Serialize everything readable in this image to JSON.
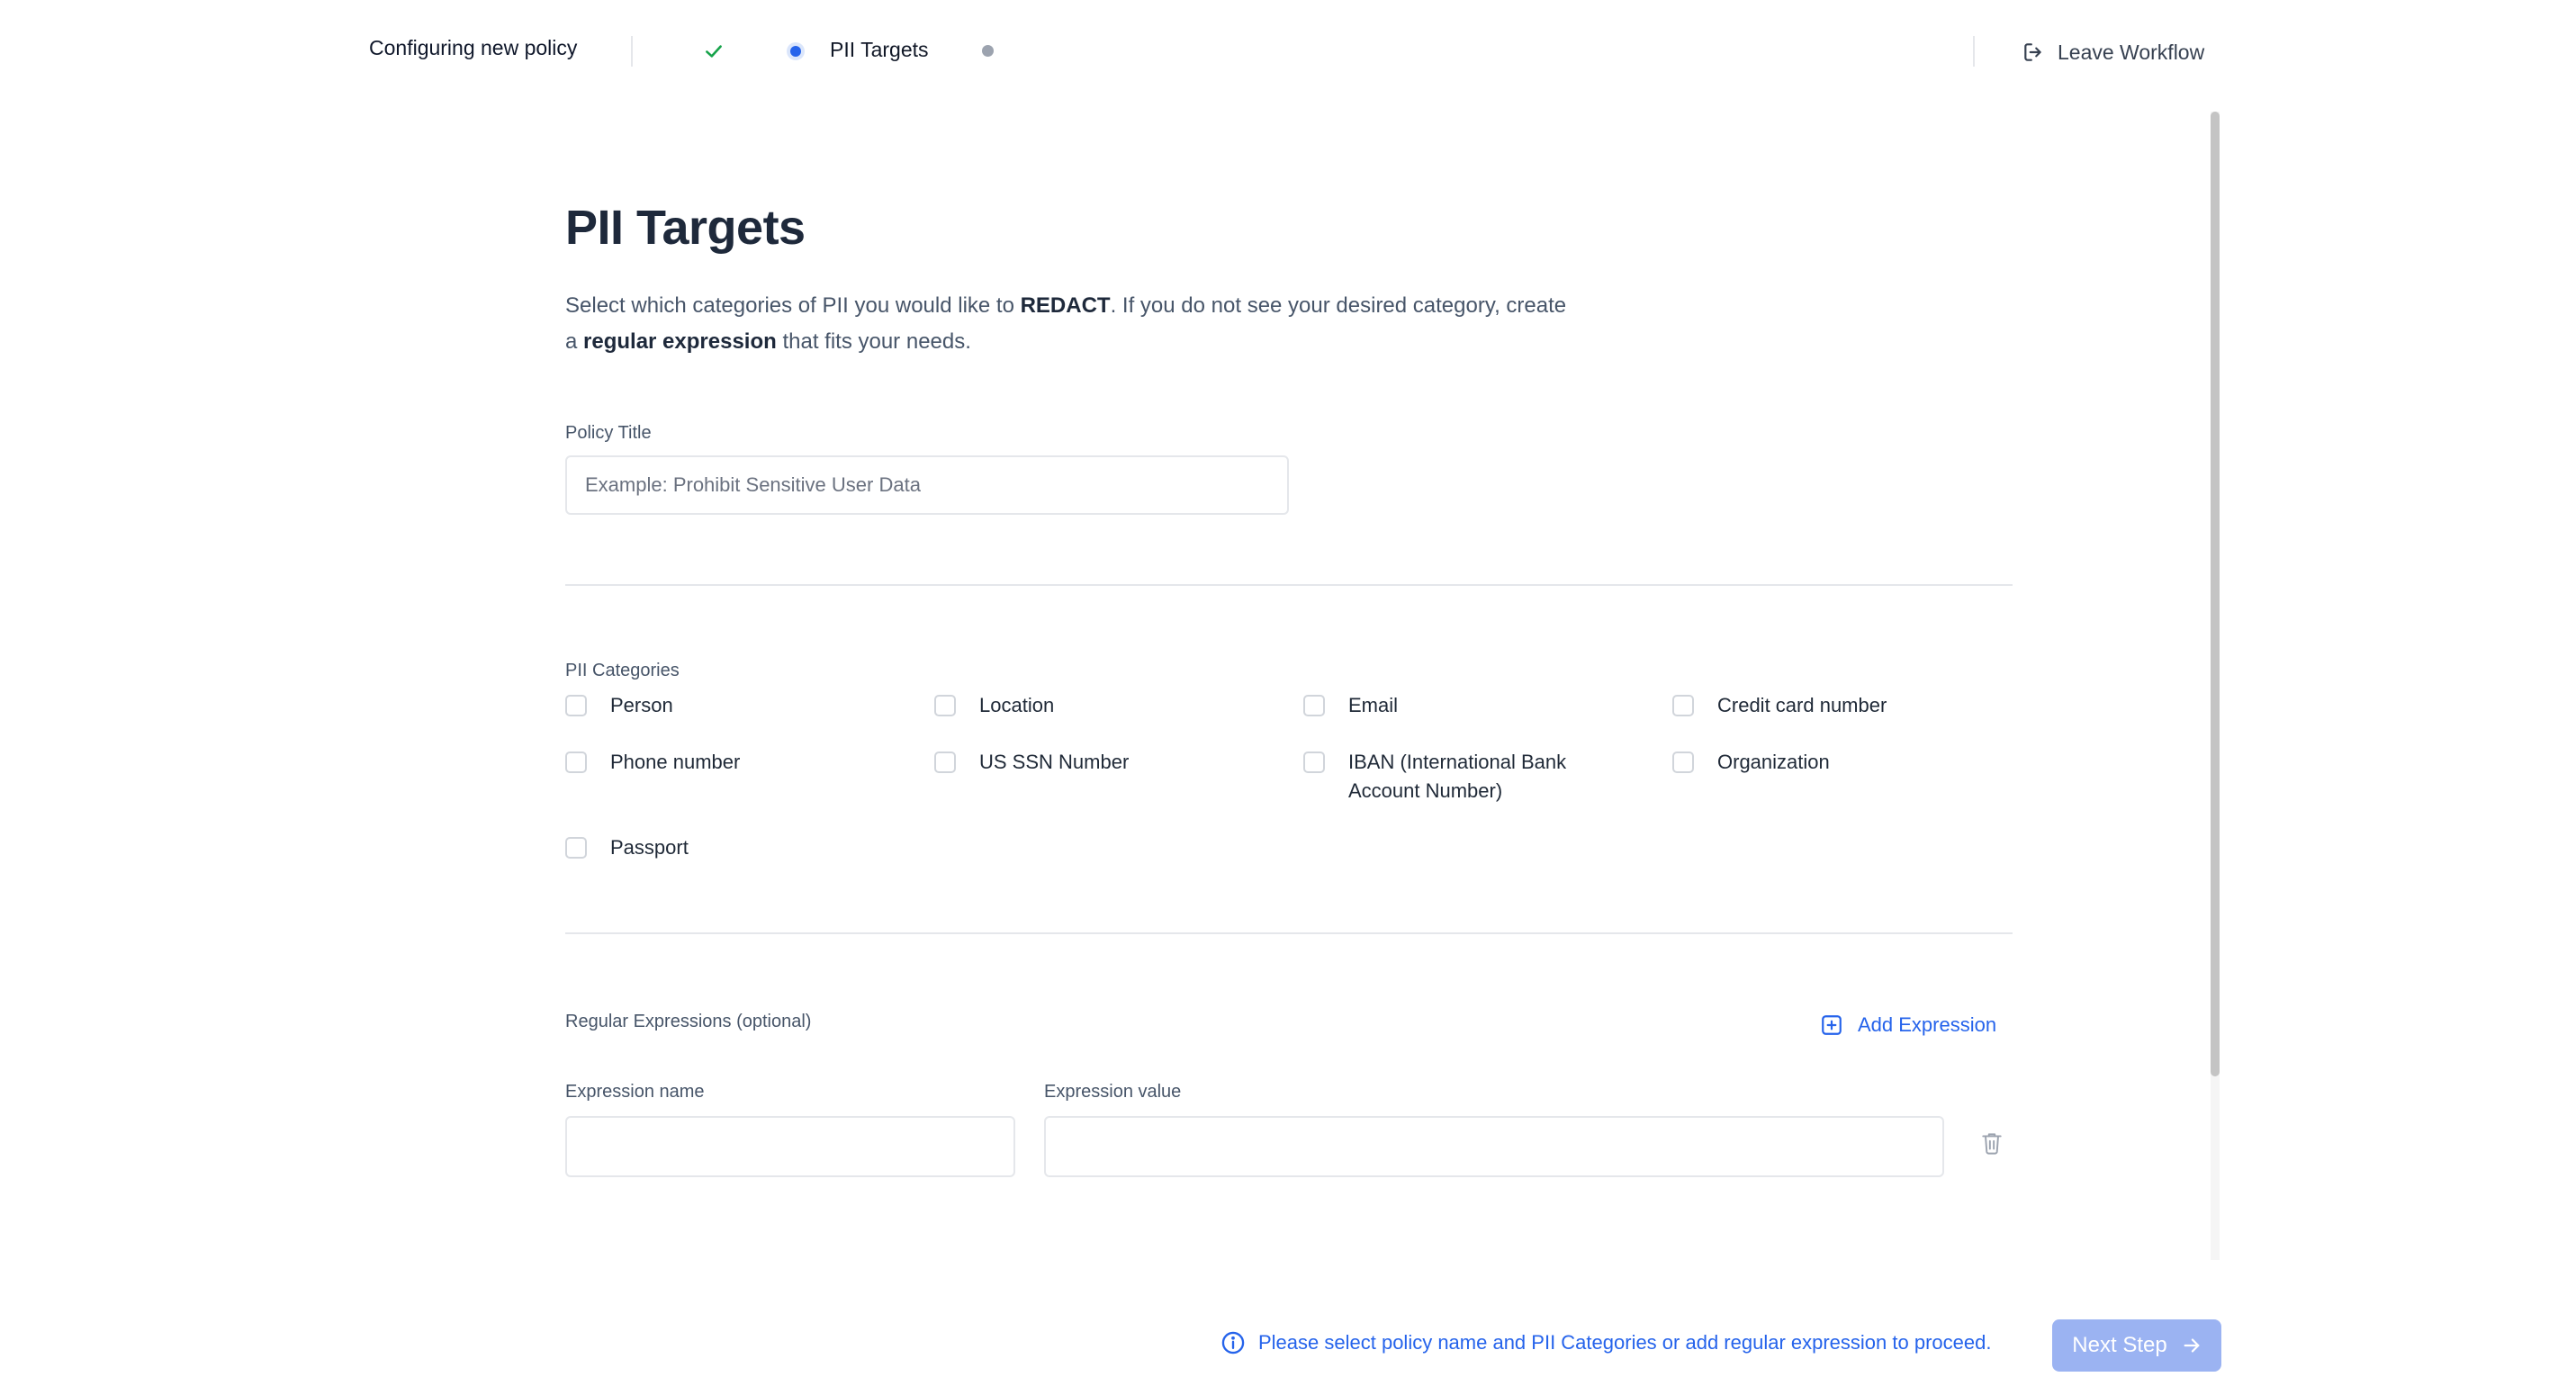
{
  "topbar": {
    "workflow_title": "Configuring new policy",
    "current_step_label": "PII Targets",
    "leave_label": "Leave Workflow"
  },
  "page": {
    "title": "PII Targets",
    "intro_part1": "Select which categories of PII you would like to ",
    "intro_bold1": "REDACT",
    "intro_part2": ". If you do not see your desired category, create a ",
    "intro_bold2": "regular expression",
    "intro_part3": " that fits your needs."
  },
  "policy_title": {
    "label": "Policy Title",
    "value": "",
    "placeholder": "Example: Prohibit Sensitive User Data"
  },
  "categories": {
    "label": "PII Categories",
    "items": [
      {
        "label": "Person",
        "checked": false
      },
      {
        "label": "Location",
        "checked": false
      },
      {
        "label": "Email",
        "checked": false
      },
      {
        "label": "Credit card number",
        "checked": false
      },
      {
        "label": "Phone number",
        "checked": false
      },
      {
        "label": "US SSN Number",
        "checked": false
      },
      {
        "label": "IBAN (International Bank Account Number)",
        "checked": false
      },
      {
        "label": "Organization",
        "checked": false
      },
      {
        "label": "Passport",
        "checked": false
      }
    ]
  },
  "regex": {
    "label": "Regular Expressions (optional)",
    "add_label": "Add Expression",
    "name_label": "Expression name",
    "value_label": "Expression value",
    "name_value": "",
    "value_value": ""
  },
  "footer": {
    "notice": "Please select policy name and PII Categories or add regular expression to proceed.",
    "next_label": "Next Step"
  },
  "colors": {
    "accent": "#2563eb",
    "next_button_disabled": "#9bb3f2",
    "step_done": "#16a34a"
  },
  "icons": {
    "step_done": "check-icon",
    "leave": "logout-icon",
    "add": "plus-square-icon",
    "delete": "trash-icon",
    "info": "info-circle-icon",
    "next": "arrow-right-icon"
  }
}
